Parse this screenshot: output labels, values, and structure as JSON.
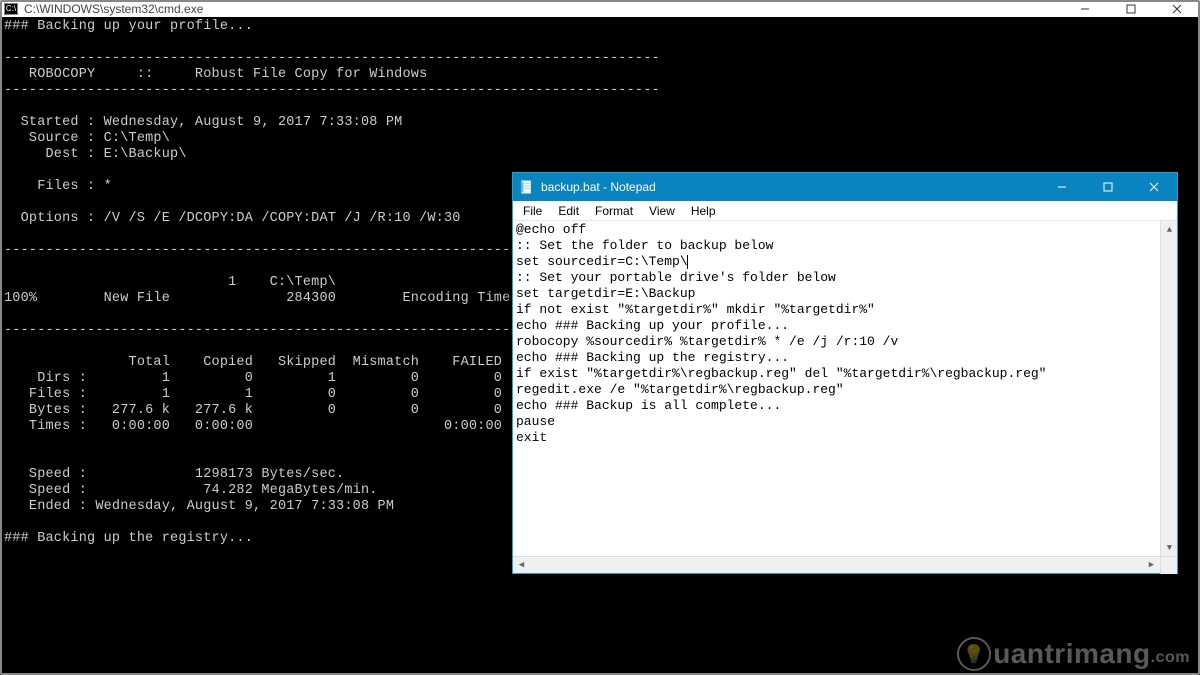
{
  "cmd": {
    "title": "C:\\WINDOWS\\system32\\cmd.exe",
    "icon_label": "C:\\",
    "output": "### Backing up your profile...\n\n-------------------------------------------------------------------------------\n   ROBOCOPY     ::     Robust File Copy for Windows\n-------------------------------------------------------------------------------\n\n  Started : Wednesday, August 9, 2017 7:33:08 PM\n   Source : C:\\Temp\\\n     Dest : E:\\Backup\\\n\n    Files : *\n\n  Options : /V /S /E /DCOPY:DA /COPY:DAT /J /R:10 /W:30\n\n------------------------------------------------------------------------------\n\n                           1    C:\\Temp\\\n100%        New File              284300        Encoding Time.csv\n\n------------------------------------------------------------------------------\n\n               Total    Copied   Skipped  Mismatch    FAILED    Extras\n    Dirs :         1         0         1         0         0         0\n   Files :         1         1         0         0         0         0\n   Bytes :   277.6 k   277.6 k         0         0         0         0\n   Times :   0:00:00   0:00:00                       0:00:00   0:00:00\n\n\n   Speed :             1298173 Bytes/sec.\n   Speed :              74.282 MegaBytes/min.\n   Ended : Wednesday, August 9, 2017 7:33:08 PM\n\n### Backing up the registry...\n"
  },
  "notepad": {
    "title": "backup.bat - Notepad",
    "menu": {
      "file": "File",
      "edit": "Edit",
      "format": "Format",
      "view": "View",
      "help": "Help"
    },
    "caret_after_line_index": 2,
    "content": "@echo off\n:: Set the folder to backup below\nset sourcedir=C:\\Temp\\\n:: Set your portable drive's folder below\nset targetdir=E:\\Backup\nif not exist \"%targetdir%\" mkdir \"%targetdir%\"\necho ### Backing up your profile...\nrobocopy %sourcedir% %targetdir% * /e /j /r:10 /v\necho ### Backing up the registry...\nif exist \"%targetdir%\\regbackup.reg\" del \"%targetdir%\\regbackup.reg\"\nregedit.exe /e \"%targetdir%\\regbackup.reg\"\necho ### Backup is all complete...\npause\nexit"
  },
  "watermark": {
    "text": "uantrimang",
    "suffix": ".com"
  }
}
